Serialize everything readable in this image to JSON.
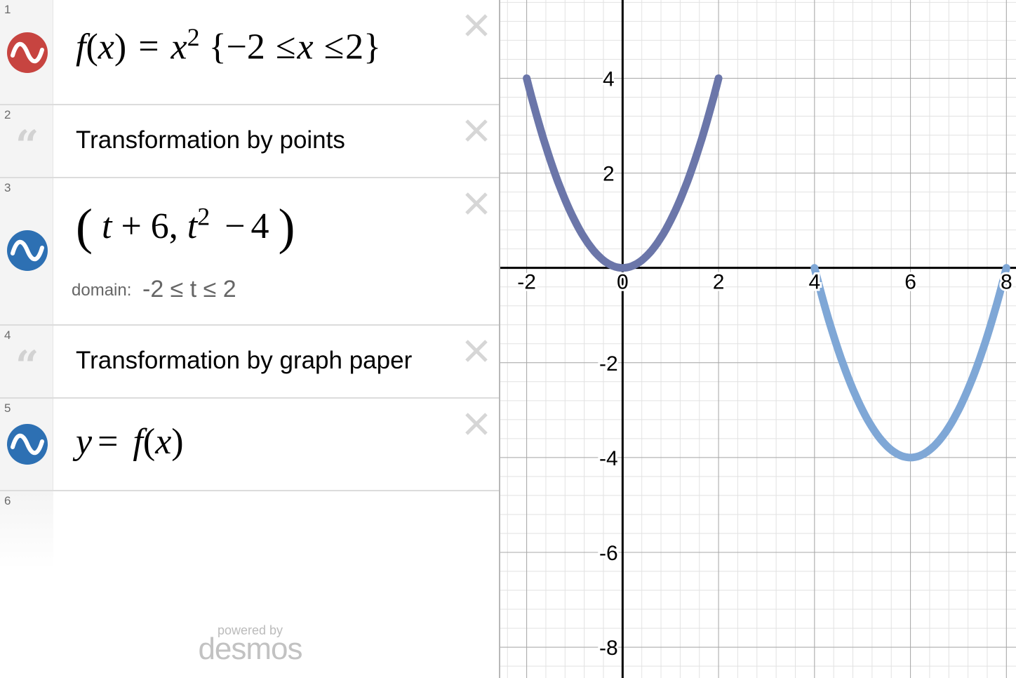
{
  "expressions": [
    {
      "num": "1",
      "kind": "expression",
      "color": "#c74440",
      "f": "f",
      "x": "x",
      "eq": "=",
      "pow": "2",
      "open": "{",
      "neg2": "−2",
      "le1": "≤",
      "le2": "≤",
      "two": "2",
      "close": "}"
    },
    {
      "num": "2",
      "kind": "note",
      "text": "Transformation by points"
    },
    {
      "num": "3",
      "kind": "expression",
      "color": "#2d70b3",
      "lp": "(",
      "t": "t",
      "plus": "+",
      "six": "6,",
      "t2": "t",
      "pow": "2",
      "minus": "−",
      "four": "4",
      "rp": ")",
      "domain_label": "domain:",
      "domain_value": "-2 ≤ t ≤ 2"
    },
    {
      "num": "4",
      "kind": "note",
      "text": "Transformation by graph paper"
    },
    {
      "num": "5",
      "kind": "expression",
      "color": "#2d70b3",
      "y": "y",
      "eq": "=",
      "f": "f",
      "x": "x",
      "lp": "(",
      "rp": ")"
    },
    {
      "num": "6",
      "kind": "empty"
    }
  ],
  "branding": {
    "powered": "powered by",
    "name": "desmos"
  },
  "chart_data": {
    "type": "line",
    "xlim": [
      -2.55,
      8.2
    ],
    "ylim": [
      -8.65,
      5.65
    ],
    "grid": true,
    "x_ticks": [
      "-2",
      "0",
      "2",
      "4",
      "6",
      "8"
    ],
    "y_ticks": [
      "4",
      "2",
      "-2",
      "-4",
      "-6",
      "-8"
    ],
    "series": [
      {
        "color": "#6b76a9",
        "x": [
          -2,
          -1.5,
          -1,
          -0.5,
          0,
          0.5,
          1,
          1.5,
          2
        ],
        "y": [
          4,
          2.25,
          1,
          0.25,
          0,
          0.25,
          1,
          2.25,
          4
        ]
      },
      {
        "color": "#7fa7d6",
        "x": [
          4,
          4.5,
          5,
          5.5,
          6,
          6.5,
          7,
          7.5,
          8
        ],
        "y": [
          0,
          -1.75,
          -3,
          -3.75,
          -4,
          -3.75,
          -3,
          -1.75,
          0
        ]
      }
    ]
  }
}
